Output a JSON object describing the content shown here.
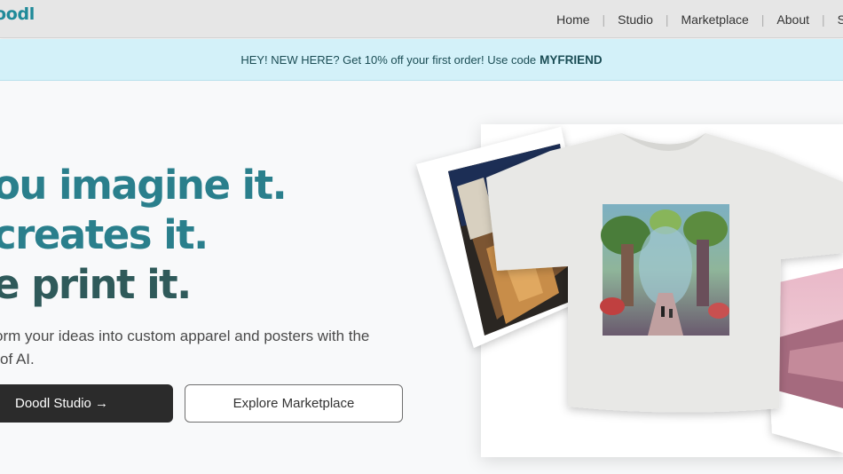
{
  "brand": {
    "logo": "oodl"
  },
  "nav": {
    "items": [
      {
        "label": "Home"
      },
      {
        "label": "Studio"
      },
      {
        "label": "Marketplace"
      },
      {
        "label": "About"
      },
      {
        "label": "S"
      }
    ],
    "separator": "|"
  },
  "promo": {
    "text": "HEY! NEW HERE? Get 10% off your first order! Use code",
    "code": "MYFRIEND"
  },
  "hero": {
    "line1": "ou imagine it.",
    "line2": "creates it.",
    "line3": "e print it.",
    "subtitle_line1": "orm your ideas into custom apparel and posters with the",
    "subtitle_line2": "of AI."
  },
  "buttons": {
    "primary": "Doodl Studio →",
    "secondary": "Explore Marketplace"
  },
  "colors": {
    "accent": "#2a7f8c",
    "dark_heading": "#2f5a5a",
    "promo_bg": "#d3f1f9",
    "nav_bg": "#e6e6e6",
    "button_dark": "#2b2b2b"
  }
}
